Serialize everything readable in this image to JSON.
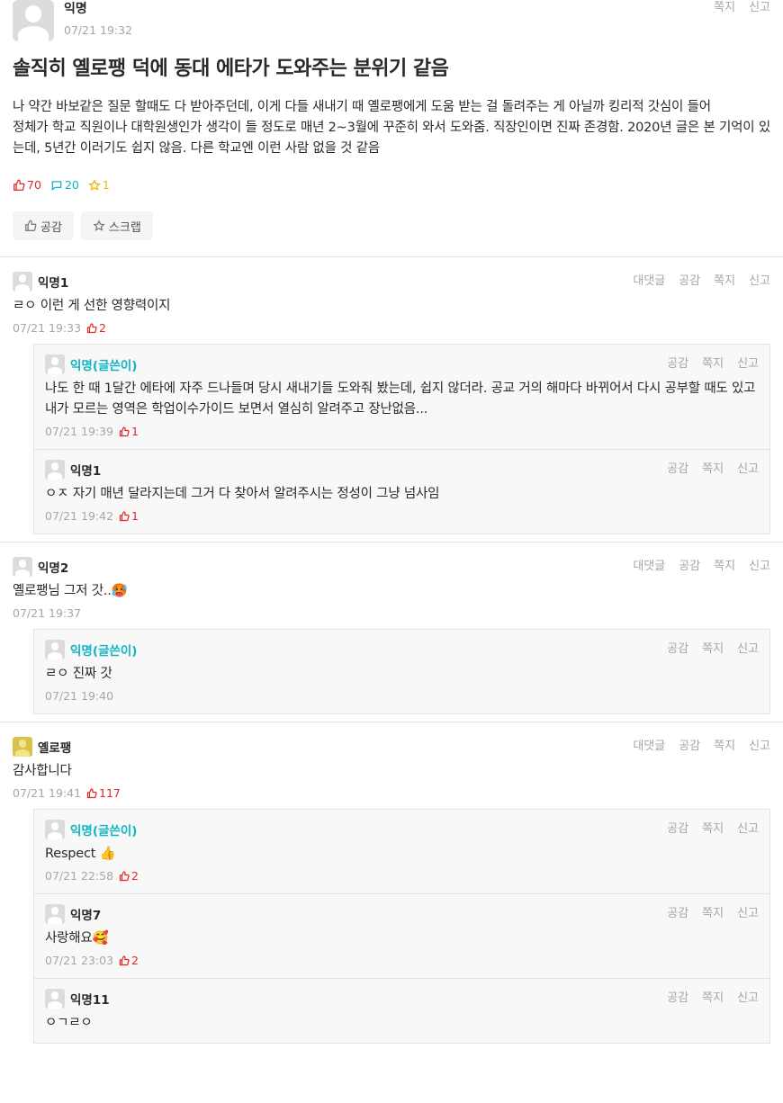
{
  "post": {
    "nickname": "익명",
    "time": "07/21 19:32",
    "actions": [
      "쪽지",
      "신고"
    ],
    "title": "솔직히 옐로팽 덕에 동대 에타가 도와주는 분위기 같음",
    "content_line1": "나 약간 바보같은 질문 할때도 다 받아주던데, 이게 다들 새내기 때 옐로팽에게 도움 받는 걸 돌려주는 게 아닐까 킹리적 갓심이 들어",
    "content_line2": "정체가 학교 직원이나 대학원생인가 생각이 들 정도로 매년 2~3월에 꾸준히 와서 도와줌. 직장인이면 진짜 존경함. 2020년 글은 본 기억이 있는데, 5년간 이러기도 쉽지 않음. 다른 학교엔 이런 사람 없을 것 같음",
    "vote_count": "70",
    "comment_count": "20",
    "scrap_count": "1",
    "vote_button": "공감",
    "scrap_button": "스크랩"
  },
  "comment_actions": {
    "reply": "대댓글",
    "vote": "공감",
    "message": "쪽지",
    "report": "신고"
  },
  "comments": [
    {
      "nickname": "익명1",
      "text": "ㄹㅇ 이런 게 선한 영향력이지",
      "time": "07/21 19:33",
      "votes": "2",
      "children": [
        {
          "nickname": "익명(글쓴이)",
          "text": "나도 한 때 1달간 에타에 자주 드나들며 당시 새내기들 도와줘 봤는데, 쉽지 않더라. 공교 거의 해마다 바뀌어서 다시 공부할 때도 있고 내가 모르는 영역은 학업이수가이드 보면서 열심히 알려주고 장난없음...",
          "time": "07/21 19:39",
          "votes": "1"
        },
        {
          "nickname": "익명1",
          "text": "ㅇㅈ 자기 매년 달라지는데 그거 다 찾아서 알려주시는 정성이 그냥 넘사임",
          "time": "07/21 19:42",
          "votes": "1"
        }
      ]
    },
    {
      "nickname": "익명2",
      "text": "옐로팽님 그저 갓..🥵",
      "time": "07/21 19:37",
      "votes": "",
      "children": [
        {
          "nickname": "익명(글쓴이)",
          "text": "ㄹㅇ 진짜 갓",
          "time": "07/21 19:40",
          "votes": ""
        }
      ]
    },
    {
      "nickname": "옐로팽",
      "text": "감사합니다",
      "time": "07/21 19:41",
      "votes": "117",
      "children": [
        {
          "nickname": "익명(글쓴이)",
          "text": "Respect 👍",
          "time": "07/21 22:58",
          "votes": "2"
        },
        {
          "nickname": "익명7",
          "text": "사랑해요🥰",
          "time": "07/21 23:03",
          "votes": "2"
        },
        {
          "nickname": "익명11",
          "text": "ㅇㄱㄹㅇ",
          "time": "",
          "votes": ""
        }
      ]
    }
  ],
  "colors": {
    "writer": "#0cb4c4",
    "vote": "#e02828",
    "scrap": "#f0b400",
    "muted": "#a6a6a6"
  }
}
